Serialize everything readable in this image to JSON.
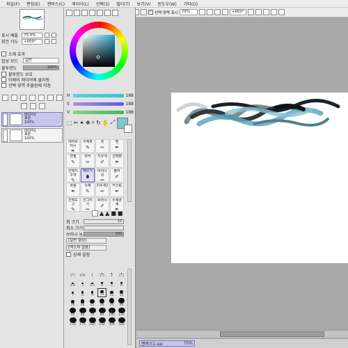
{
  "menu": [
    "파일(F)",
    "편집(E)",
    "캔버스(C)",
    "레이어(L)",
    "선택(S)",
    "필터(T)",
    "보기(V)",
    "윈도우(W)",
    "기타(O)"
  ],
  "toolbar": {
    "selection_check_label": "선택 영역 표시",
    "zoom_value": "75%",
    "angle_value": "+000°"
  },
  "navigator": {
    "zoom_label": "표시 배율",
    "zoom_value": "75.0%",
    "angle_label": "회전 각도",
    "angle_value": "+000°"
  },
  "layer_props": {
    "effect_header": "소재 효과",
    "blend_label": "합성 모드",
    "blend_value": "일반",
    "opacity_label": "불투명도",
    "opacity_value": "100%",
    "opacity_pct": 100,
    "protect_label": "불투명도 보호",
    "clip_label": "아래의 레이어에 클리핑",
    "ref_label": "선택 영역 추출원에 지정"
  },
  "layers": [
    {
      "name": "레이어2",
      "mode": "표준",
      "opacity": "100%",
      "selected": true
    },
    {
      "name": "레이어1",
      "mode": "표준",
      "opacity": "100%",
      "selected": false
    }
  ],
  "color": {
    "hue_color": "#3fc9e6",
    "sq_color": "#2a9cc2",
    "main_color": "#7dc6d4",
    "slider_values": [
      "188",
      "188",
      "188"
    ]
  },
  "tools": [
    {
      "label": "에어브러시",
      "icon": "✒"
    },
    {
      "label": "수채붓",
      "icon": "✎"
    },
    {
      "label": "붓",
      "icon": "✏"
    },
    {
      "label": "펜",
      "icon": "✒"
    },
    {
      "label": "연필",
      "icon": "✎"
    },
    {
      "label": "마커",
      "icon": "✏"
    },
    {
      "label": "지우개",
      "icon": "✐"
    },
    {
      "label": "선택펜",
      "icon": "✒"
    },
    {
      "label": "선택지우개",
      "icon": "✎"
    },
    {
      "label": "채우기",
      "icon": "⬮"
    },
    {
      "label": "바이너리",
      "icon": "✏"
    },
    {
      "label": "블러",
      "icon": "✐"
    },
    {
      "label": "흐림",
      "icon": "✒"
    },
    {
      "label": "수채",
      "icon": "✎"
    },
    {
      "label": "지우개2",
      "icon": "✏"
    },
    {
      "label": "커스텀",
      "icon": "✒"
    },
    {
      "label": "선택도구",
      "icon": "✎"
    },
    {
      "label": "선그리기",
      "icon": "✏"
    },
    {
      "label": "브러시",
      "icon": "✐"
    },
    {
      "label": "수채경계",
      "icon": "✒"
    }
  ],
  "brush_settings": {
    "size_label": "최 크기",
    "size_value": "10",
    "min_label": "최소 크기",
    "density_label": "브러시 농도",
    "density_value": "100",
    "shape_label": "[일반 형상]",
    "texture_label": "[텍스처 없음]",
    "expand_label": "상세 설정"
  },
  "brush_sizes": [
    "0.7",
    "0.8",
    "1",
    "1.5",
    "2",
    "2.3",
    "2.6",
    "3",
    "3.5",
    "4",
    "5",
    "6",
    "7",
    "8",
    "9",
    "10",
    "12",
    "14",
    "16",
    "20",
    "25",
    "30",
    "35",
    "40",
    "50",
    "60",
    "70",
    "80",
    "100",
    "120",
    "150",
    "170",
    "200",
    "250",
    "300",
    "350"
  ],
  "status": {
    "doc_name": "캔버스1.sai",
    "doc_zoom": "75%"
  }
}
